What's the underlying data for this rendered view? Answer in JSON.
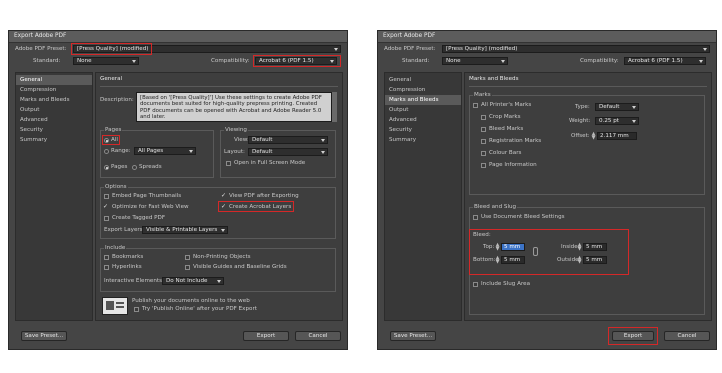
{
  "left": {
    "title": "Export Adobe PDF",
    "preset_label": "Adobe PDF Preset:",
    "preset_value": "[Press Quality] (modified)",
    "standard_label": "Standard:",
    "standard_value": "None",
    "compat_label": "Compatibility:",
    "compat_value": "Acrobat 6 (PDF 1.5)",
    "sidebar": [
      "General",
      "Compression",
      "Marks and Bleeds",
      "Output",
      "Advanced",
      "Security",
      "Summary"
    ],
    "panel_title": "General",
    "description_label": "Description:",
    "description_text": "[Based on '[Press Quality]'] Use these settings to create Adobe PDF documents best suited for high-quality prepress printing. Created PDF documents can be opened with Acrobat and Adobe Reader 5.0 and later.",
    "pages_title": "Pages",
    "all_label": "All",
    "range_label": "Range:",
    "range_value": "All Pages",
    "pages_label": "Pages",
    "spreads_label": "Spreads",
    "viewing_title": "Viewing",
    "view_label": "View:",
    "view_value": "Default",
    "layout_label": "Layout:",
    "layout_value": "Default",
    "fullscreen_label": "Open in Full Screen Mode",
    "options_title": "Options",
    "thumbnails_label": "Embed Page Thumbnails",
    "fastweb_label": "Optimize for Fast Web View",
    "tagged_label": "Create Tagged PDF",
    "viewafter_label": "View PDF after Exporting",
    "layers_label": "Create Acrobat Layers",
    "export_layers_label": "Export Layers:",
    "export_layers_value": "Visible & Printable Layers",
    "include_title": "Include",
    "bookmarks_label": "Bookmarks",
    "hyperlinks_label": "Hyperlinks",
    "nonprinting_label": "Non-Printing Objects",
    "guides_label": "Visible Guides and Baseline Grids",
    "interactive_label": "Interactive Elements:",
    "interactive_value": "Do Not Include",
    "publish_text": "Publish your documents online to the web",
    "publish_try": "Try 'Publish Online' after your PDF Export",
    "save_preset": "Save Preset...",
    "export": "Export",
    "cancel": "Cancel"
  },
  "right": {
    "title": "Export Adobe PDF",
    "preset_label": "Adobe PDF Preset:",
    "preset_value": "[Press Quality] (modified)",
    "standard_label": "Standard:",
    "standard_value": "None",
    "compat_label": "Compatibility:",
    "compat_value": "Acrobat 6 (PDF 1.5)",
    "sidebar": [
      "General",
      "Compression",
      "Marks and Bleeds",
      "Output",
      "Advanced",
      "Security",
      "Summary"
    ],
    "panel_title": "Marks and Bleeds",
    "marks_title": "Marks",
    "all_marks": "All Printer's Marks",
    "crop": "Crop Marks",
    "bleed_marks": "Bleed Marks",
    "registration": "Registration Marks",
    "colour_bars": "Colour Bars",
    "page_info": "Page Information",
    "type_label": "Type:",
    "type_value": "Default",
    "weight_label": "Weight:",
    "weight_value": "0.25 pt",
    "offset_label": "Offset:",
    "offset_value": "2.117 mm",
    "bleed_slug_title": "Bleed and Slug",
    "use_doc_bleed": "Use Document Bleed Settings",
    "bleed_title": "Bleed:",
    "top_label": "Top:",
    "top_value": "5 mm",
    "bottom_label": "Bottom:",
    "bottom_value": "5 mm",
    "inside_label": "Inside:",
    "inside_value": "5 mm",
    "outside_label": "Outside:",
    "outside_value": "5 mm",
    "slug_label": "Include Slug Area",
    "save_preset": "Save Preset...",
    "export": "Export",
    "cancel": "Cancel"
  },
  "colors": {
    "dialog_bg": "#454545",
    "highlight": "#d42828",
    "selection": "#3c73c6"
  }
}
